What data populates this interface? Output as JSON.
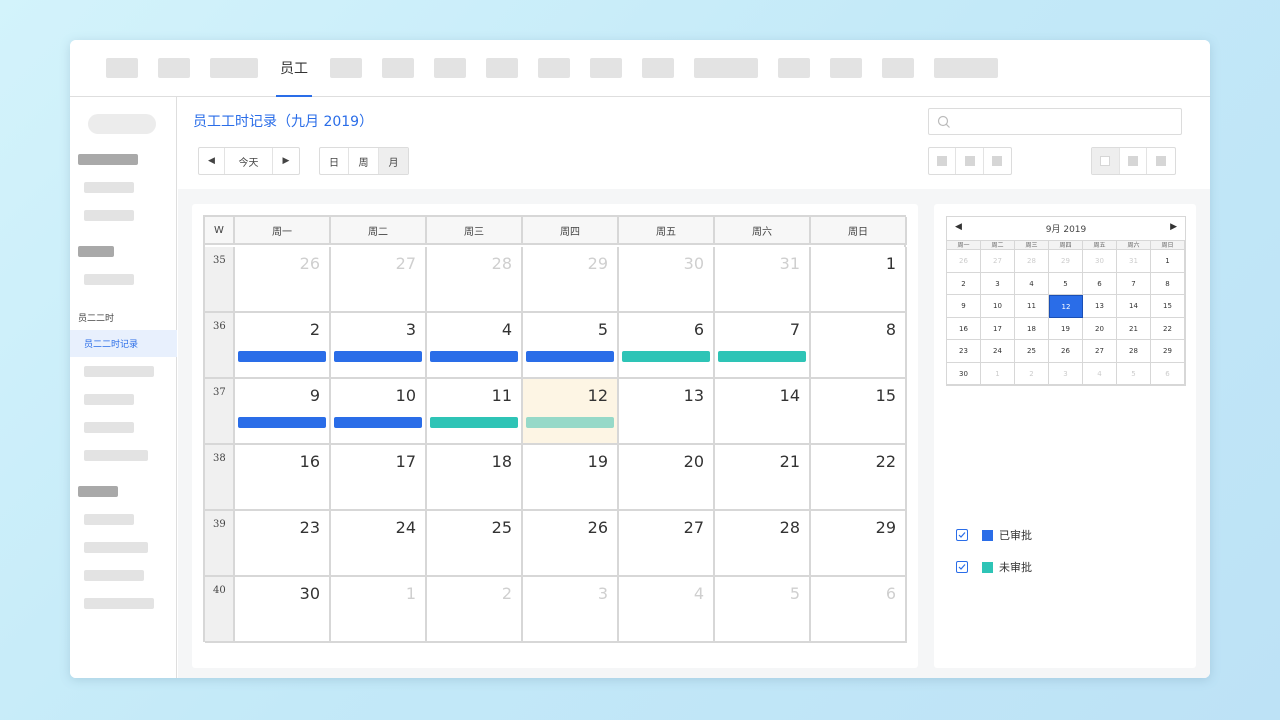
{
  "topnav": {
    "active_tab": "员工"
  },
  "sidebar": {
    "section_label": "员二二时",
    "active_item": "员二二时记录"
  },
  "header": {
    "title": "员工工时记录（九月 2019）",
    "nav": {
      "prev": "◀",
      "today": "今天",
      "next": "▶"
    },
    "views": {
      "day": "日",
      "week": "周",
      "month": "月",
      "selected": "month"
    }
  },
  "calendar": {
    "week_header": "W",
    "weekdays": [
      "周一",
      "周二",
      "周三",
      "周四",
      "周五",
      "周六",
      "周日"
    ],
    "weeks": [
      {
        "week": "35",
        "days": [
          {
            "d": "26",
            "other": true
          },
          {
            "d": "27",
            "other": true
          },
          {
            "d": "28",
            "other": true
          },
          {
            "d": "29",
            "other": true
          },
          {
            "d": "30",
            "other": true
          },
          {
            "d": "31",
            "other": true
          },
          {
            "d": "1"
          }
        ]
      },
      {
        "week": "36",
        "days": [
          {
            "d": "2",
            "status": "approved"
          },
          {
            "d": "3",
            "status": "approved"
          },
          {
            "d": "4",
            "status": "approved"
          },
          {
            "d": "5",
            "status": "approved"
          },
          {
            "d": "6",
            "status": "pending"
          },
          {
            "d": "7",
            "status": "pending"
          },
          {
            "d": "8"
          }
        ]
      },
      {
        "week": "37",
        "days": [
          {
            "d": "9",
            "status": "approved"
          },
          {
            "d": "10",
            "status": "approved"
          },
          {
            "d": "11",
            "status": "pending"
          },
          {
            "d": "12",
            "status": "pending-light",
            "today": true
          },
          {
            "d": "13"
          },
          {
            "d": "14"
          },
          {
            "d": "15"
          }
        ]
      },
      {
        "week": "38",
        "days": [
          {
            "d": "16"
          },
          {
            "d": "17"
          },
          {
            "d": "18"
          },
          {
            "d": "19"
          },
          {
            "d": "20"
          },
          {
            "d": "21"
          },
          {
            "d": "22"
          }
        ]
      },
      {
        "week": "39",
        "days": [
          {
            "d": "23"
          },
          {
            "d": "24"
          },
          {
            "d": "25"
          },
          {
            "d": "26"
          },
          {
            "d": "27"
          },
          {
            "d": "28"
          },
          {
            "d": "29"
          }
        ]
      },
      {
        "week": "40",
        "days": [
          {
            "d": "30"
          },
          {
            "d": "1",
            "other": true
          },
          {
            "d": "2",
            "other": true
          },
          {
            "d": "3",
            "other": true
          },
          {
            "d": "4",
            "other": true
          },
          {
            "d": "5",
            "other": true
          },
          {
            "d": "6",
            "other": true
          }
        ]
      }
    ]
  },
  "mini_calendar": {
    "title": "9月  2019",
    "prev": "◀",
    "next": "▶",
    "weekdays": [
      "周一",
      "周二",
      "周三",
      "周四",
      "周五",
      "周六",
      "周日"
    ],
    "rows": [
      [
        {
          "d": "26",
          "o": true
        },
        {
          "d": "27",
          "o": true
        },
        {
          "d": "28",
          "o": true
        },
        {
          "d": "29",
          "o": true
        },
        {
          "d": "30",
          "o": true
        },
        {
          "d": "31",
          "o": true
        },
        {
          "d": "1"
        }
      ],
      [
        {
          "d": "2"
        },
        {
          "d": "3"
        },
        {
          "d": "4"
        },
        {
          "d": "5"
        },
        {
          "d": "6"
        },
        {
          "d": "7"
        },
        {
          "d": "8"
        }
      ],
      [
        {
          "d": "9"
        },
        {
          "d": "10"
        },
        {
          "d": "11"
        },
        {
          "d": "12",
          "sel": true
        },
        {
          "d": "13"
        },
        {
          "d": "14"
        },
        {
          "d": "15"
        }
      ],
      [
        {
          "d": "16"
        },
        {
          "d": "17"
        },
        {
          "d": "18"
        },
        {
          "d": "19"
        },
        {
          "d": "20"
        },
        {
          "d": "21"
        },
        {
          "d": "22"
        }
      ],
      [
        {
          "d": "23"
        },
        {
          "d": "24"
        },
        {
          "d": "25"
        },
        {
          "d": "26"
        },
        {
          "d": "27"
        },
        {
          "d": "28"
        },
        {
          "d": "29"
        }
      ],
      [
        {
          "d": "30"
        },
        {
          "d": "1",
          "o": true
        },
        {
          "d": "2",
          "o": true
        },
        {
          "d": "3",
          "o": true
        },
        {
          "d": "4",
          "o": true
        },
        {
          "d": "5",
          "o": true
        },
        {
          "d": "6",
          "o": true
        }
      ]
    ]
  },
  "legend": [
    {
      "label": "已审批",
      "color": "#2a6de8"
    },
    {
      "label": "未审批",
      "color": "#2ec4b6"
    }
  ],
  "colors": {
    "accent": "#2a6de8",
    "approved": "#2a6de8",
    "pending": "#2ec4b6",
    "pending_light": "#96d9c8",
    "today_bg": "#fdf5e4"
  }
}
